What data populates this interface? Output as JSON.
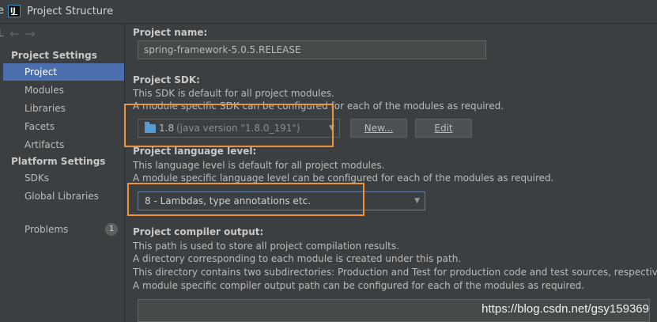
{
  "window": {
    "title": "Project Structure",
    "edge_char": "e",
    "app_icon_text": "IJ"
  },
  "sidebar": {
    "edge_char": "L",
    "nav_arrows": "←→",
    "sections": [
      {
        "header": "Project Settings",
        "items": [
          "Project",
          "Modules",
          "Libraries",
          "Facets",
          "Artifacts"
        ]
      },
      {
        "header": "Platform Settings",
        "items": [
          "SDKs",
          "Global Libraries"
        ]
      }
    ],
    "problems": {
      "label": "Problems",
      "count": "1"
    },
    "selected": "Project"
  },
  "main": {
    "project_name": {
      "label": "Project name:",
      "value": "spring-framework-5.0.5.RELEASE"
    },
    "project_sdk": {
      "label": "Project SDK:",
      "desc1": "This SDK is default for all project modules.",
      "desc2": "A module specific SDK can be configured for each of the modules as required.",
      "selected_version": "1.8",
      "selected_detail": "(java version \"1.8.0_191\")",
      "new_button": "New...",
      "edit_button": "Edit"
    },
    "language_level": {
      "label": "Project language level:",
      "desc1": "This language level is default for all project modules.",
      "desc2": "A module specific language level can be configured for each of the modules as required.",
      "selected": "8 - Lambdas, type annotations etc."
    },
    "compiler_output": {
      "label": "Project compiler output:",
      "desc1": "This path is used to store all project compilation results.",
      "desc2": "A directory corresponding to each module is created under this path.",
      "desc3": "This directory contains two subdirectories: Production and Test for production code and test sources, respectively.",
      "desc4": "A module specific compiler output path can be configured for each of the modules as required.",
      "value": ""
    }
  },
  "watermark": "https://blog.csdn.net/gsy159369",
  "colors": {
    "selection": "#4b6eaf",
    "highlight": "#f0913c",
    "background": "#3c3f41"
  }
}
